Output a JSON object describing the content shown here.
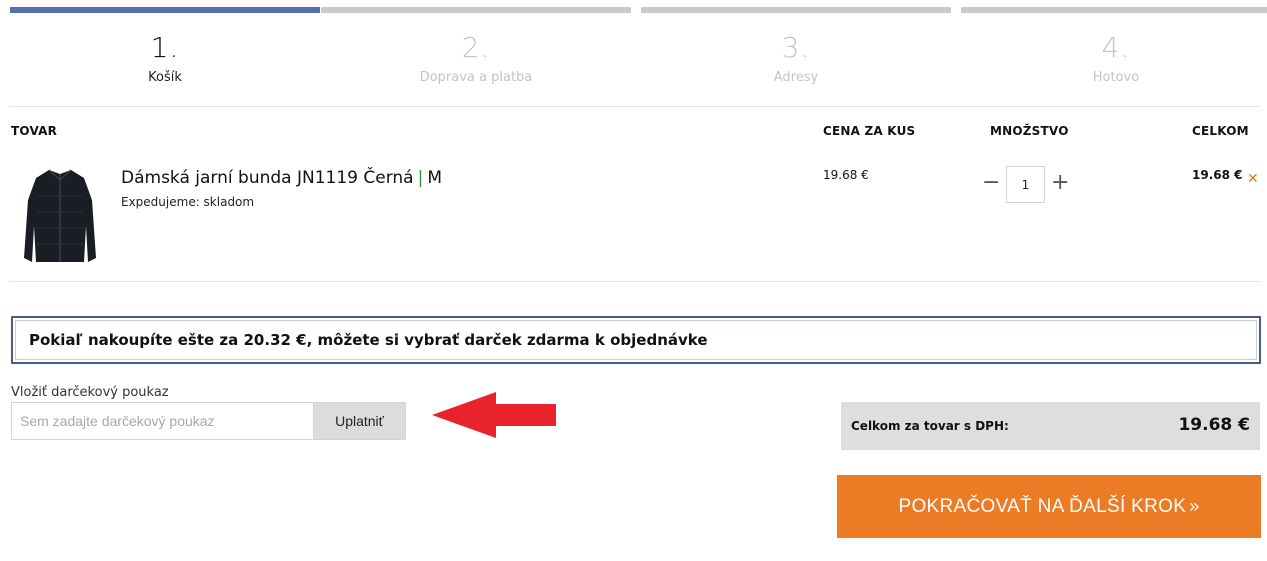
{
  "steps": [
    {
      "num": "1.",
      "label": "Košík"
    },
    {
      "num": "2.",
      "label": "Doprava a platba"
    },
    {
      "num": "3.",
      "label": "Adresy"
    },
    {
      "num": "4.",
      "label": "Hotovo"
    }
  ],
  "table": {
    "headers": {
      "product": "TOVAR",
      "unit_price": "CENA ZA KUS",
      "quantity": "MNOŽSTVO",
      "total": "CELKOM"
    },
    "rows": [
      {
        "name": "Dámská jarní bunda JN1119 Černá",
        "separator": "|",
        "size": "M",
        "stock": "Expedujeme: skladom",
        "unit_price": "19.68 €",
        "quantity": "1",
        "total": "19.68 €",
        "remove_icon": "close-icon"
      }
    ]
  },
  "qty_controls": {
    "minus": "−",
    "plus": "+"
  },
  "remove_glyph": "✕",
  "gift_banner": "Pokiaľ nakoupíte ešte za 20.32 €, môžete si vybrať darček zdarma k objednávke",
  "voucher": {
    "label": "Vložiť darčekový poukaz",
    "placeholder": "Sem zadajte darčekový poukaz",
    "button": "Uplatniť"
  },
  "summary": {
    "label": "Celkom za tovar s DPH:",
    "value": "19.68 €"
  },
  "cta": {
    "label": "POKRAČOVAŤ NA ĎALŠÍ KROK",
    "chevron": "»"
  },
  "colors": {
    "active_step": "#5470a8",
    "inactive_step": "#c9c9c9",
    "accent": "#ec7b25",
    "arrow": "#e8242a",
    "banner_border": "#4a5f86"
  }
}
